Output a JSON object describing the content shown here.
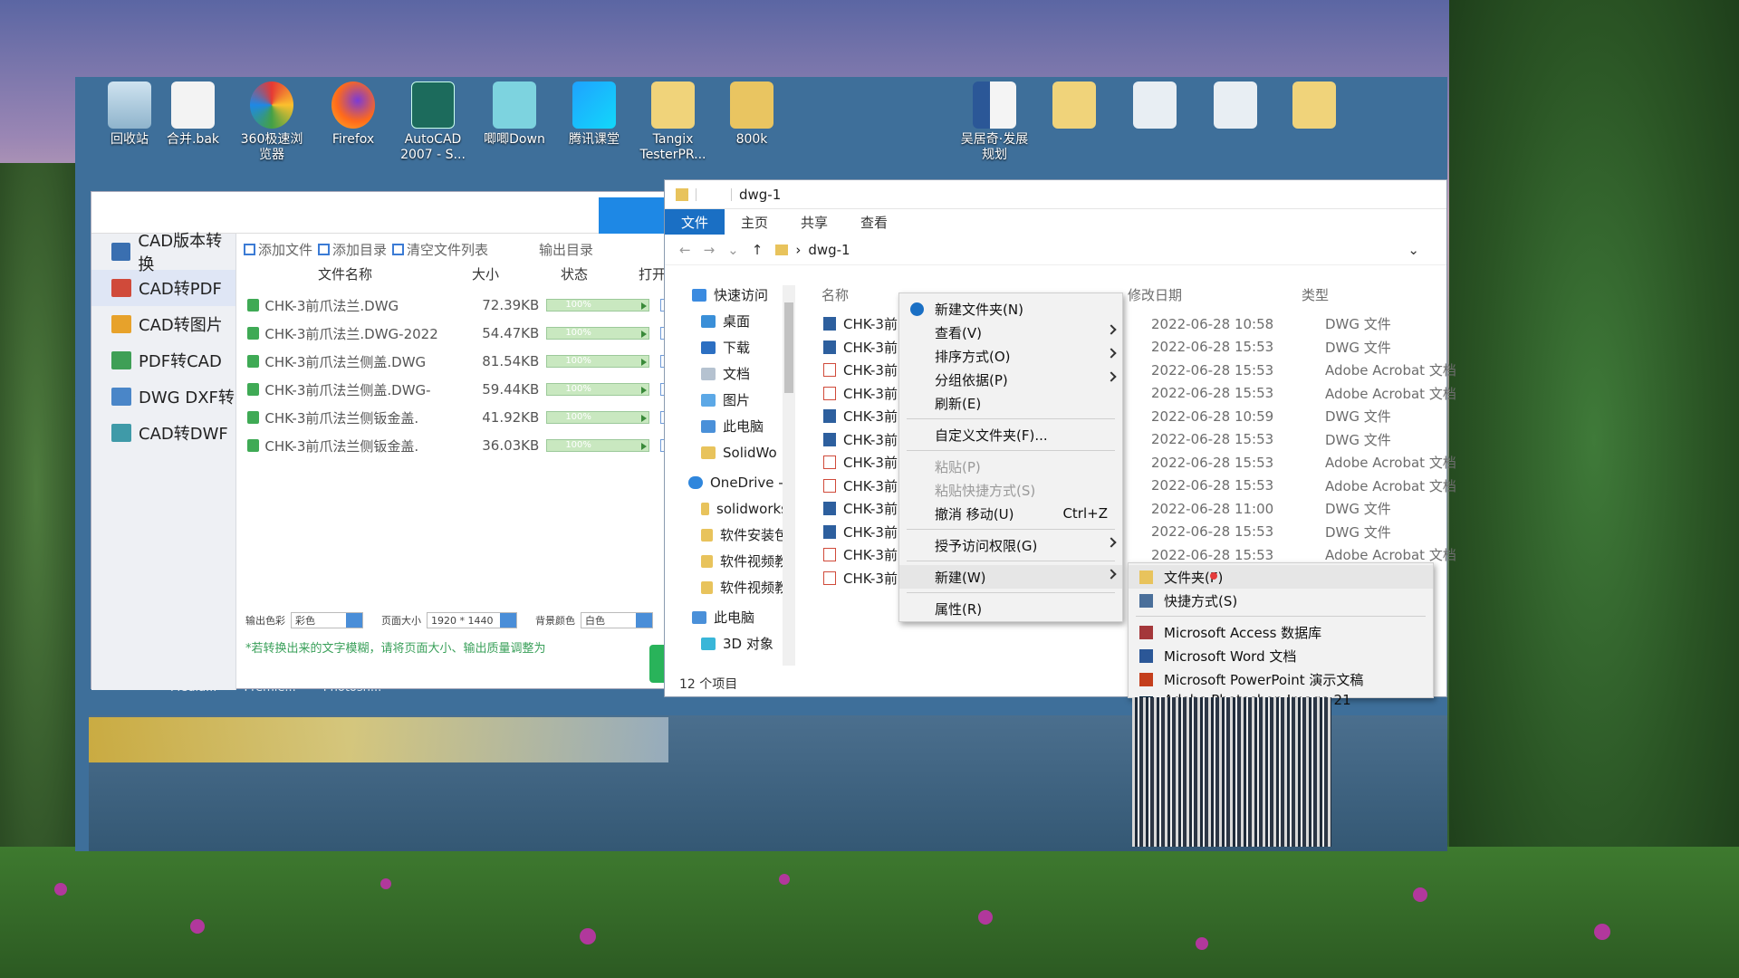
{
  "desktop_icons": [
    {
      "label": "回收站"
    },
    {
      "label": "合并.bak"
    },
    {
      "label": "360极速浏览器"
    },
    {
      "label": "Firefox"
    },
    {
      "label": "AutoCAD 2007 - S..."
    },
    {
      "label": "唧唧Down"
    },
    {
      "label": "腾讯课堂"
    },
    {
      "label": "Tangix TesterPR..."
    },
    {
      "label": "800k"
    },
    {
      "label": "吴居奇·发展规划"
    }
  ],
  "desktop_dim_labels": [
    "Media...",
    "Premie...",
    "Photosh..."
  ],
  "converter": {
    "sidebar": [
      {
        "label": "CAD版本转换"
      },
      {
        "label": "CAD转PDF"
      },
      {
        "label": "CAD转图片"
      },
      {
        "label": "PDF转CAD"
      },
      {
        "label": "DWG DXF转"
      },
      {
        "label": "CAD转DWF"
      }
    ],
    "toolbar": {
      "add_file": "添加文件",
      "add_dir": "添加目录",
      "clear_list": "清空文件列表",
      "output_dir": "输出目录"
    },
    "table_headers": {
      "name": "文件名称",
      "size": "大小",
      "status": "状态",
      "open": "打开"
    },
    "files": [
      {
        "name": "CHK-3前爪法兰.DWG",
        "size": "72.39KB",
        "progress": "100%"
      },
      {
        "name": "CHK-3前爪法兰.DWG-2022",
        "size": "54.47KB",
        "progress": "100%"
      },
      {
        "name": "CHK-3前爪法兰侧盖.DWG",
        "size": "81.54KB",
        "progress": "100%"
      },
      {
        "name": "CHK-3前爪法兰侧盖.DWG-",
        "size": "59.44KB",
        "progress": "100%"
      },
      {
        "name": "CHK-3前爪法兰侧钣金盖.",
        "size": "41.92KB",
        "progress": "100%"
      },
      {
        "name": "CHK-3前爪法兰侧钣金盖.",
        "size": "36.03KB",
        "progress": "100%"
      }
    ],
    "options": {
      "color_label": "输出色彩",
      "color_value": "彩色",
      "page_label": "页面大小",
      "page_value": "1920 * 1440",
      "bg_label": "背景颜色",
      "bg_value": "白色"
    },
    "hint": "*若转换出来的文字模糊，请将页面大小、输出质量调整为"
  },
  "explorer": {
    "title": "dwg-1",
    "ribbon": [
      "文件",
      "主页",
      "共享",
      "查看"
    ],
    "path": "dwg-1",
    "nav": [
      {
        "label": "快速访问"
      },
      {
        "label": "桌面"
      },
      {
        "label": "下载"
      },
      {
        "label": "文档"
      },
      {
        "label": "图片"
      },
      {
        "label": "此电脑"
      },
      {
        "label": "SolidWo"
      },
      {
        "label": "OneDrive -"
      },
      {
        "label": "solidworks"
      },
      {
        "label": "软件安装包"
      },
      {
        "label": "软件视频教"
      },
      {
        "label": "软件视频教"
      },
      {
        "label": "此电脑"
      },
      {
        "label": "3D 对象"
      }
    ],
    "columns": {
      "name": "名称",
      "date": "修改日期",
      "type": "类型"
    },
    "rows": [
      {
        "name": "CHK-3前",
        "date": "2022-06-28 10:58",
        "type": "DWG 文件",
        "kind": "dwg"
      },
      {
        "name": "CHK-3前",
        "date": "2022-06-28 15:53",
        "type": "DWG 文件",
        "kind": "dwg"
      },
      {
        "name": "CHK-3前",
        "date": "2022-06-28 15:53",
        "type": "Adobe Acrobat 文档",
        "kind": "pdf"
      },
      {
        "name": "CHK-3前",
        "date": "2022-06-28 15:53",
        "type": "Adobe Acrobat 文档",
        "kind": "pdf"
      },
      {
        "name": "CHK-3前",
        "date": "2022-06-28 10:59",
        "type": "DWG 文件",
        "kind": "dwg"
      },
      {
        "name": "CHK-3前",
        "date": "2022-06-28 15:53",
        "type": "DWG 文件",
        "kind": "dwg"
      },
      {
        "name": "CHK-3前",
        "date": "2022-06-28 15:53",
        "type": "Adobe Acrobat 文档",
        "kind": "pdf"
      },
      {
        "name": "CHK-3前",
        "date": "2022-06-28 15:53",
        "type": "Adobe Acrobat 文档",
        "kind": "pdf"
      },
      {
        "name": "CHK-3前",
        "date": "2022-06-28 11:00",
        "type": "DWG 文件",
        "kind": "dwg"
      },
      {
        "name": "CHK-3前",
        "date": "2022-06-28 15:53",
        "type": "DWG 文件",
        "kind": "dwg"
      },
      {
        "name": "CHK-3前",
        "date": "2022-06-28 15:53",
        "type": "Adobe Acrobat 文档",
        "kind": "pdf"
      },
      {
        "name": "CHK-3前",
        "date": "",
        "type": "",
        "kind": "pdf"
      }
    ],
    "status": "12 个项目"
  },
  "context_menu": {
    "items": {
      "new_folder": "新建文件夹(N)",
      "view": "查看(V)",
      "sort": "排序方式(O)",
      "group": "分组依据(P)",
      "refresh": "刷新(E)",
      "customize": "自定义文件夹(F)...",
      "paste": "粘贴(P)",
      "paste_shortcut": "粘贴快捷方式(S)",
      "undo_move": "撤消 移动(U)",
      "undo_shortcut": "Ctrl+Z",
      "grant_access": "授予访问权限(G)",
      "new": "新建(W)",
      "properties": "属性(R)"
    }
  },
  "new_submenu": {
    "items": {
      "folder": "文件夹(F)",
      "shortcut": "快捷方式(S)",
      "access": "Microsoft Access 数据库",
      "word": "Microsoft Word 文档",
      "ppt": "Microsoft PowerPoint 演示文稿",
      "psd": "Adobe Photoshop Image 21"
    }
  },
  "colors": {
    "accent": "#1a6fc4",
    "dwg_icon": "#2d5f9e",
    "pdf_icon": "#d04a3a",
    "progress_green": "#3faa55"
  }
}
